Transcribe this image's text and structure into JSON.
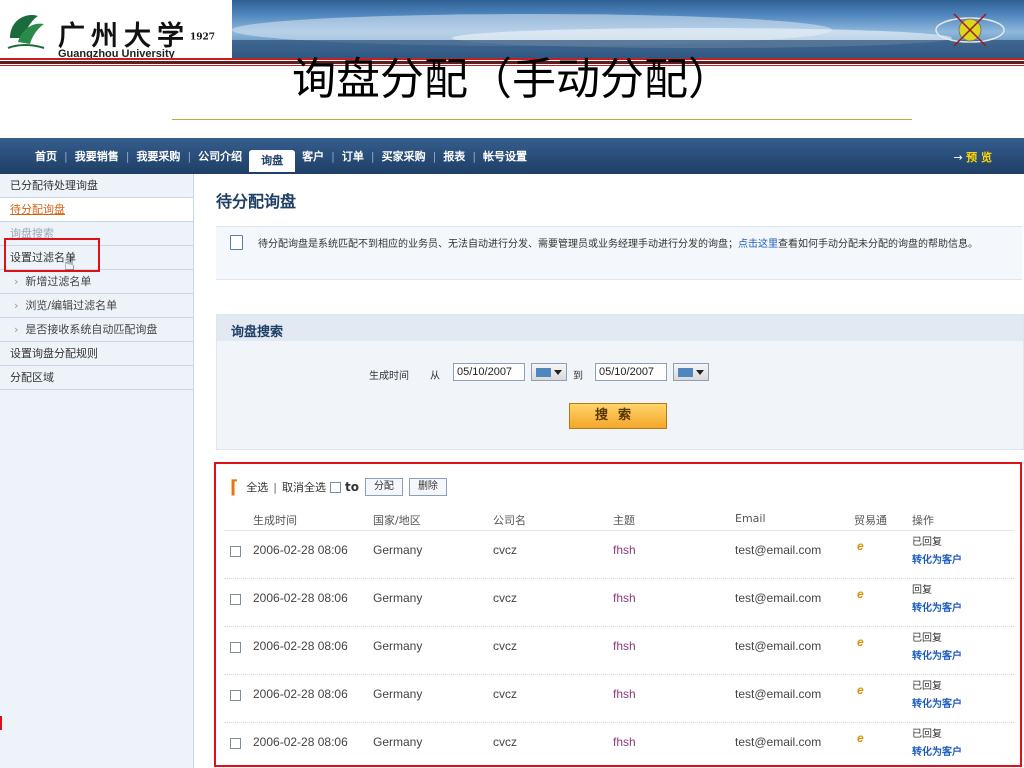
{
  "header": {
    "logo_cn": "广州大学",
    "logo_cn_small": "1927",
    "logo_en": "Guangzhou University"
  },
  "slide_title": "询盘分配（手动分配）",
  "app": {
    "topnav": {
      "items": [
        "首页",
        "我要销售",
        "我要采购",
        "公司介绍",
        "询盘",
        "客户",
        "订单",
        "买家采购",
        "报表",
        "帐号设置"
      ],
      "active_index": 4,
      "preview_arrow": "→",
      "preview_label": "预 览"
    },
    "sidebar": {
      "items": [
        {
          "label": "已分配待处理询盘"
        },
        {
          "label": "待分配询盘"
        },
        {
          "label": "询盘搜索"
        },
        {
          "label": "设置过滤名单"
        },
        {
          "label": "新增过滤名单"
        },
        {
          "label": "浏览/编辑过滤名单"
        },
        {
          "label": "是否接收系统自动匹配询盘"
        },
        {
          "label": "设置询盘分配规则"
        },
        {
          "label": "分配区域"
        }
      ]
    },
    "main": {
      "page_heading": "待分配询盘",
      "info_text": "待分配询盘是系统匹配不到相应的业务员、无法自动进行分发、需要管理员或业务经理手动进行分发的询盘；",
      "info_link": "点击这里",
      "info_text_after": "查看如何手动分配未分配的询盘的帮助信息。",
      "search": {
        "title": "询盘搜索",
        "gen_time_label": "生成时间",
        "from_label": "从",
        "from_date": "05/10/2007",
        "to_label": "到",
        "to_date": "05/10/2007",
        "search_button": "搜索"
      },
      "results": {
        "select_all": "全选",
        "deselect_all": "取消全选",
        "to_label": "to",
        "assign_button": "分配",
        "delete_button": "删除",
        "columns": [
          "生成时间",
          "国家/地区",
          "公司名",
          "主题",
          "Email",
          "贸易通",
          "操作"
        ],
        "rows": [
          {
            "time": "2006-02-28 08:06",
            "country": "Germany",
            "company": "cvcz",
            "subject": "fhsh",
            "email": "test@email.com",
            "status": "已回复",
            "action": "转化为客户"
          },
          {
            "time": "2006-02-28 08:06",
            "country": "Germany",
            "company": "cvcz",
            "subject": "fhsh",
            "email": "test@email.com",
            "status": "回复",
            "action": "转化为客户"
          },
          {
            "time": "2006-02-28 08:06",
            "country": "Germany",
            "company": "cvcz",
            "subject": "fhsh",
            "email": "test@email.com",
            "status": "已回复",
            "action": "转化为客户"
          },
          {
            "time": "2006-02-28 08:06",
            "country": "Germany",
            "company": "cvcz",
            "subject": "fhsh",
            "email": "test@email.com",
            "status": "已回复",
            "action": "转化为客户"
          },
          {
            "time": "2006-02-28 08:06",
            "country": "Germany",
            "company": "cvcz",
            "subject": "fhsh",
            "email": "test@email.com",
            "status": "已回复",
            "action": "转化为客户"
          }
        ]
      }
    }
  },
  "colors": {
    "nav_bg": "#1e3f66",
    "highlight_red": "#e0101a",
    "link_blue": "#1d5cbf",
    "active_orange": "#d2651a",
    "search_button": "#f4a62a"
  }
}
